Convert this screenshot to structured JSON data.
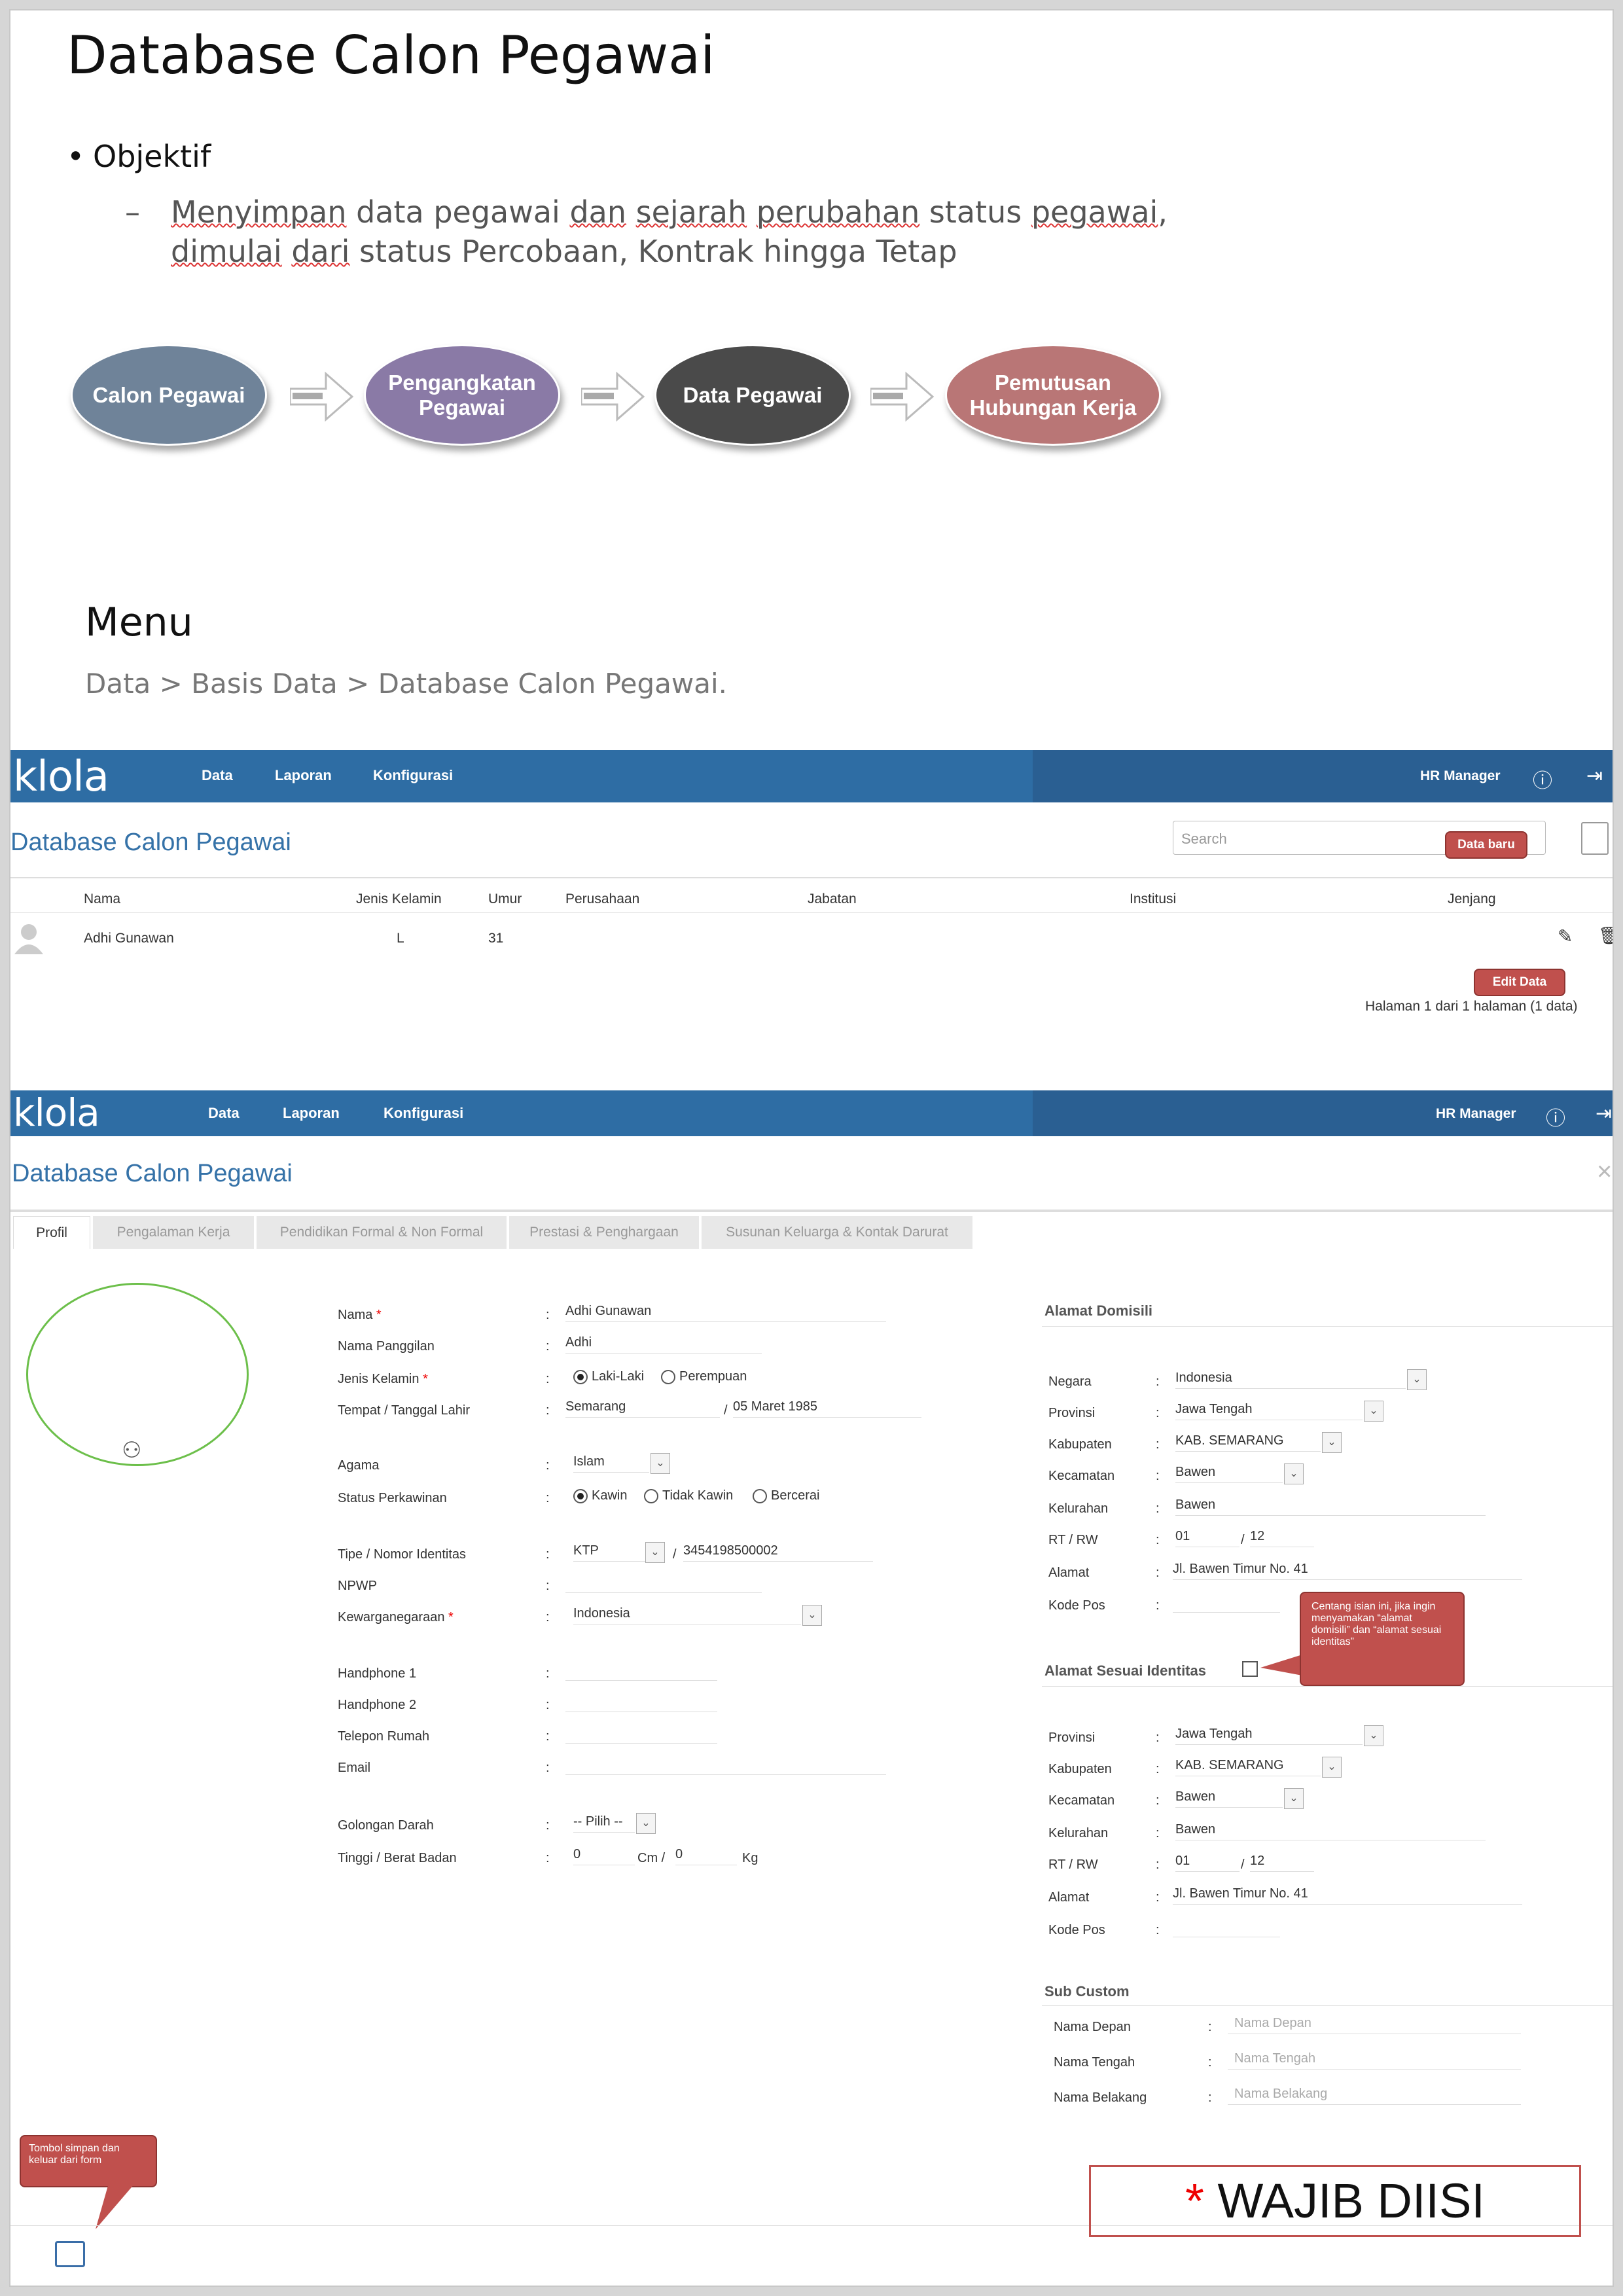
{
  "slide": {
    "title": "Database Calon Pegawai",
    "bullet": "Objektif",
    "objective_line1_a": "Menyimpan",
    "objective_line1_b": "data pegawai",
    "objective_line1_c": "dan",
    "objective_line1_d": "sejarah",
    "objective_line1_e": "perubahan",
    "objective_line1_f": "status",
    "objective_line1_g": "pegawai",
    "objective_line1_h": ",",
    "objective_line2_a": "dimulai",
    "objective_line2_b": "dari",
    "objective_line2_c": "status Percobaan, Kontrak hingga Tetap",
    "flow": [
      {
        "label_l1": "Calon Pegawai",
        "label_l2": "",
        "color": "#6f8399"
      },
      {
        "label_l1": "Pengangkatan",
        "label_l2": "Pegawai",
        "color": "#8a7aa6"
      },
      {
        "label_l1": "Data Pegawai",
        "label_l2": "",
        "color": "#4a4a4a"
      },
      {
        "label_l1": "Pemutusan",
        "label_l2": "Hubungan Kerja",
        "color": "#b97676"
      }
    ],
    "menu_title": "Menu",
    "menu_path": "Data > Basis Data > Database Calon Pegawai."
  },
  "list_screen": {
    "logo": "klola",
    "nav": [
      "Data",
      "Laporan",
      "Konfigurasi"
    ],
    "user": "HR Manager",
    "page_title": "Database Calon Pegawai",
    "search_placeholder": "Search",
    "columns": [
      "Nama",
      "Jenis Kelamin",
      "Umur",
      "Perusahaan",
      "Jabatan",
      "Institusi",
      "Jenjang"
    ],
    "row": {
      "nama": "Adhi Gunawan",
      "jk": "L",
      "umur": "31"
    },
    "pagination": "Halaman 1 dari 1 halaman (1 data)",
    "callout_new": "Data baru",
    "callout_edit": "Edit Data"
  },
  "form_screen": {
    "logo": "klola",
    "nav": [
      "Data",
      "Laporan",
      "Konfigurasi"
    ],
    "user": "HR Manager",
    "page_title": "Database Calon Pegawai",
    "tabs": [
      "Profil",
      "Pengalaman Kerja",
      "Pendidikan Formal & Non Formal",
      "Prestasi & Penghargaan",
      "Susunan Keluarga & Kontak Darurat"
    ],
    "left": {
      "nama_label": "Nama",
      "nama": "Adhi Gunawan",
      "panggilan_label": "Nama Panggilan",
      "panggilan": "Adhi",
      "jk_label": "Jenis Kelamin",
      "jk_opt1": "Laki-Laki",
      "jk_opt2": "Perempuan",
      "ttl_label": "Tempat / Tanggal Lahir",
      "tempat": "Semarang",
      "tanggal": "05 Maret 1985",
      "agama_label": "Agama",
      "agama": "Islam",
      "status_label": "Status Perkawinan",
      "st_opt1": "Kawin",
      "st_opt2": "Tidak Kawin",
      "st_opt3": "Bercerai",
      "id_label": "Tipe / Nomor Identitas",
      "id_type": "KTP",
      "id_no": "3454198500002",
      "npwp_label": "NPWP",
      "warga_label": "Kewarganegaraan",
      "warga": "Indonesia",
      "hp1_label": "Handphone 1",
      "hp2_label": "Handphone 2",
      "telp_label": "Telepon Rumah",
      "email_label": "Email",
      "darah_label": "Golongan Darah",
      "darah": "-- Pilih --",
      "tb_label": "Tinggi / Berat Badan",
      "tinggi": "0",
      "cm": "Cm /",
      "berat": "0",
      "kg": "Kg"
    },
    "domisili": {
      "title": "Alamat Domisili",
      "negara_label": "Negara",
      "negara": "Indonesia",
      "provinsi_label": "Provinsi",
      "provinsi": "Jawa Tengah",
      "kabupaten_label": "Kabupaten",
      "kabupaten": "KAB. SEMARANG",
      "kecamatan_label": "Kecamatan",
      "kecamatan": "Bawen",
      "kelurahan_label": "Kelurahan",
      "kelurahan": "Bawen",
      "rtrw_label": "RT / RW",
      "rt": "01",
      "rw": "12",
      "alamat_label": "Alamat",
      "alamat": "Jl. Bawen Timur No. 41",
      "kodepos_label": "Kode Pos"
    },
    "identitas": {
      "title": "Alamat Sesuai Identitas",
      "provinsi_label": "Provinsi",
      "provinsi": "Jawa Tengah",
      "kabupaten_label": "Kabupaten",
      "kabupaten": "KAB. SEMARANG",
      "kecamatan_label": "Kecamatan",
      "kecamatan": "Bawen",
      "kelurahan_label": "Kelurahan",
      "kelurahan": "Bawen",
      "rtrw_label": "RT / RW",
      "rt": "01",
      "rw": "12",
      "alamat_label": "Alamat",
      "alamat": "Jl. Bawen Timur No. 41",
      "kodepos_label": "Kode Pos"
    },
    "subcustom": {
      "title": "Sub Custom",
      "depan_label": "Nama Depan",
      "depan_ph": "Nama Depan",
      "tengah_label": "Nama Tengah",
      "tengah_ph": "Nama Tengah",
      "belakang_label": "Nama Belakang",
      "belakang_ph": "Nama Belakang"
    },
    "callout_centang": "Centang isian ini, jika ingin menyamakan “alamat domisili” dan “alamat sesuai identitas”",
    "callout_save": "Tombol simpan dan keluar dari form",
    "wajib_star": "*",
    "wajib_text": " WAJIB DIISI"
  }
}
